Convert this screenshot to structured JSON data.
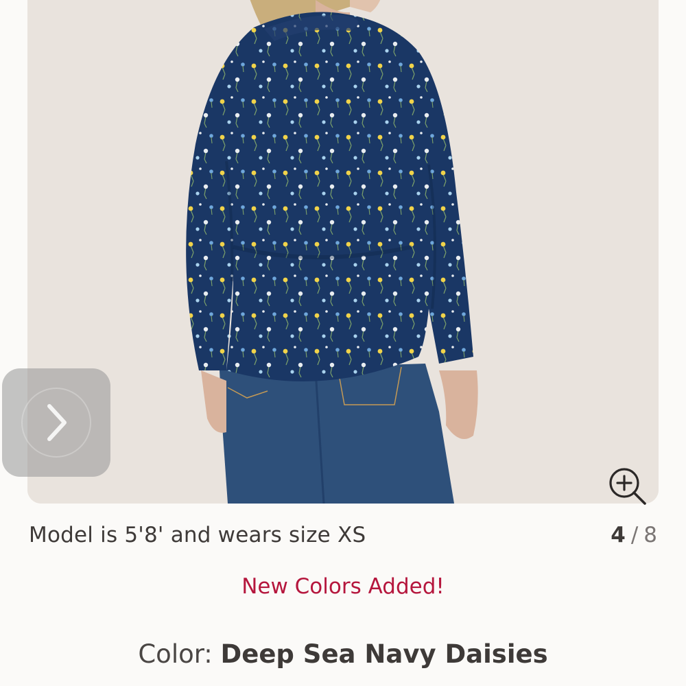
{
  "gallery": {
    "caption": "Model is 5'8' and wears size XS",
    "current_index": "4",
    "separator": "/",
    "total": "8",
    "next_icon": "chevron-right-icon",
    "zoom_icon": "zoom-in-icon"
  },
  "promo": {
    "text": "New Colors Added!"
  },
  "color": {
    "label": "Color:",
    "value": "Deep Sea Navy Daisies"
  },
  "colors": {
    "background": "#fbfaf8",
    "image_bg": "#e8e2dc",
    "shirt": "#1a3765",
    "jeans": "#2e507a",
    "promo": "#b5163d",
    "text": "#3e3a38"
  }
}
